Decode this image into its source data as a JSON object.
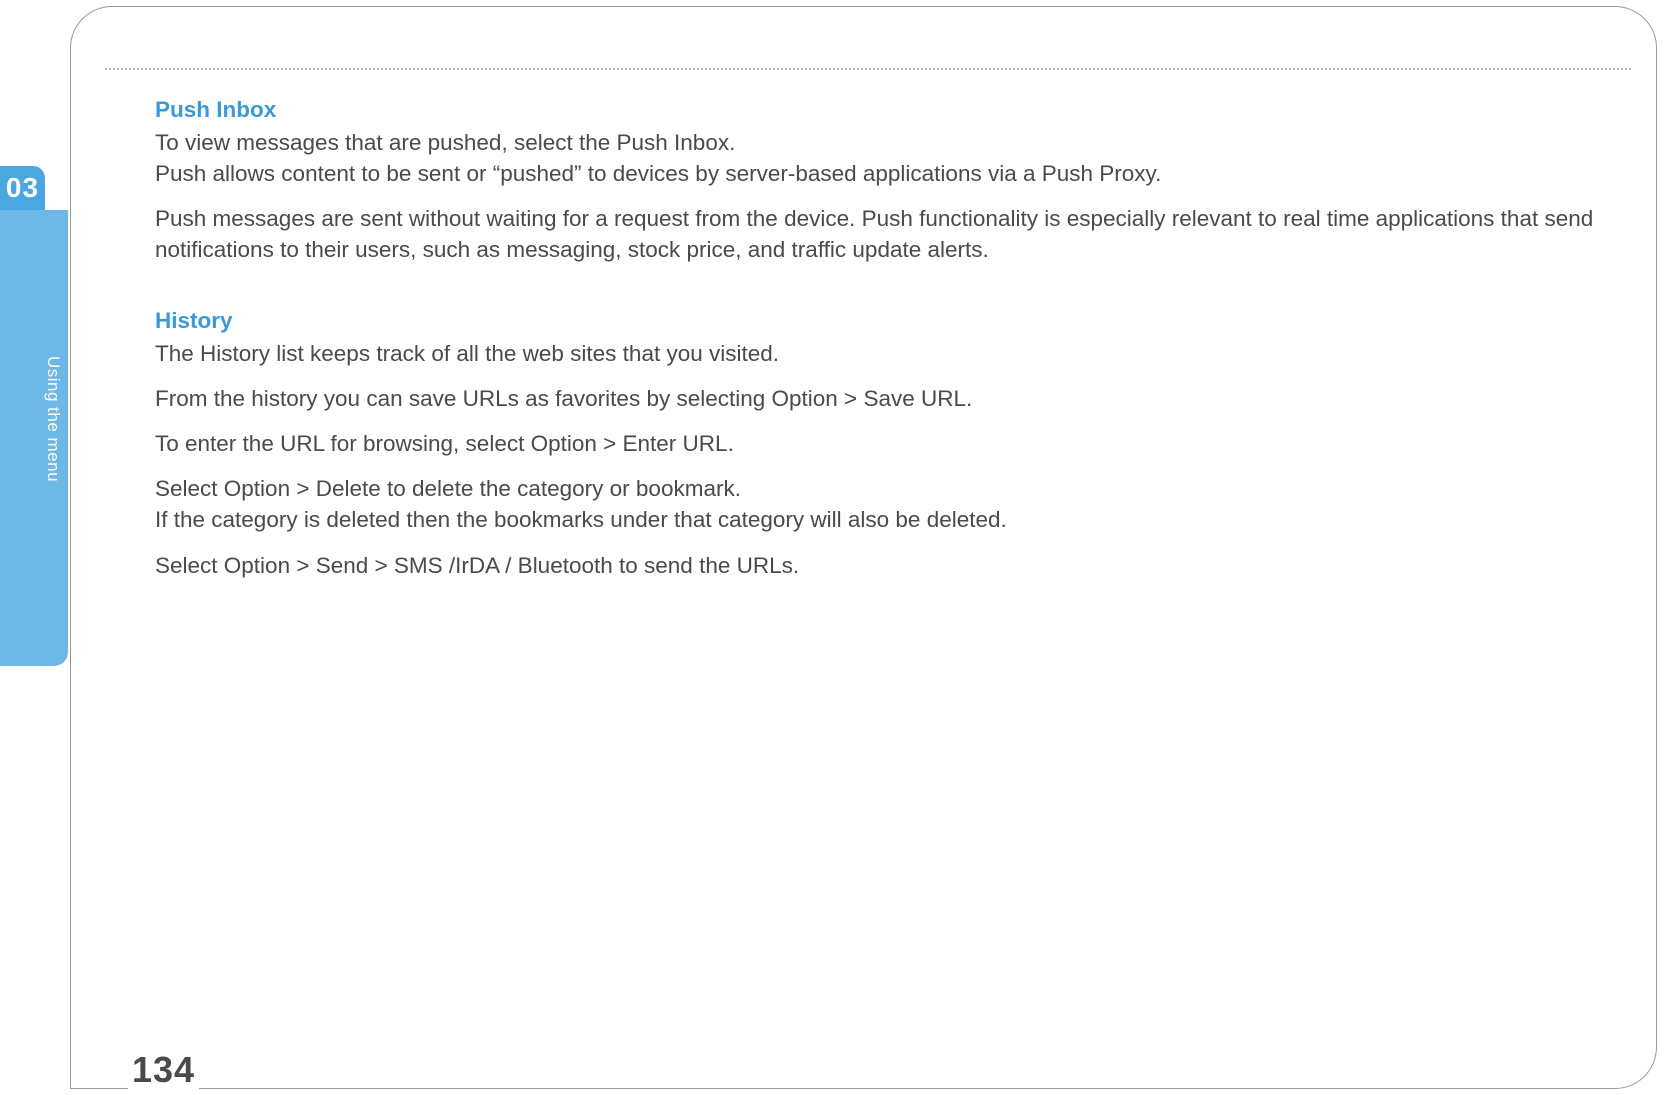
{
  "chapter": {
    "number": "03",
    "title": "Using the menu"
  },
  "page_number": "134",
  "sections": {
    "push_inbox": {
      "heading": "Push Inbox",
      "p1": "To view messages that are pushed, select the Push Inbox.",
      "p2": "Push allows content to be sent or “pushed” to devices by server-based applications via a Push Proxy.",
      "p3": "Push messages are sent without waiting for a request from the device. Push functionality is especially relevant to real time applications that send notifications to their users, such as messaging, stock price, and traffic update alerts."
    },
    "history": {
      "heading": "History",
      "p1": "The History list keeps track of all the web sites that you visited.",
      "p2": "From the history you can save URLs as favorites by selecting Option > Save URL.",
      "p3": "To enter the URL for browsing, select Option > Enter URL.",
      "p4": "Select Option > Delete to delete the category or bookmark.",
      "p5": "If the category is deleted then the bookmarks under that category will also be deleted.",
      "p6": "Select Option > Send > SMS /IrDA / Bluetooth to send the URLs."
    }
  }
}
